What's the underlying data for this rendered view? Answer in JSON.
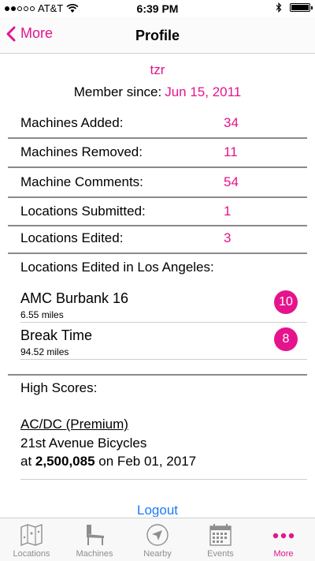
{
  "status_bar": {
    "carrier": "AT&T",
    "time": "6:39 PM"
  },
  "nav": {
    "back_label": "More",
    "title": "Profile"
  },
  "profile": {
    "username": "tzr",
    "member_since_label": "Member since:",
    "member_since_date": "Jun 15, 2011"
  },
  "stats": [
    {
      "label": "Machines Added:",
      "value": "34"
    },
    {
      "label": "Machines Removed:",
      "value": "11"
    },
    {
      "label": "Machine Comments:",
      "value": "54"
    },
    {
      "label": "Locations Submitted:",
      "value": "1"
    },
    {
      "label": "Locations Edited:",
      "value": "3"
    }
  ],
  "locations_section": {
    "title": "Locations Edited in Los Angeles:",
    "items": [
      {
        "name": "AMC Burbank 16",
        "distance": "6.55 miles",
        "count": "10"
      },
      {
        "name": "Break Time",
        "distance": "94.52 miles",
        "count": "8"
      }
    ]
  },
  "high_scores": {
    "title": "High Scores:",
    "entries": [
      {
        "machine": "AC/DC (Premium)",
        "location": "21st Avenue Bicycles",
        "at": "at",
        "score": "2,500,085",
        "on": "on Feb 01, 2017"
      }
    ]
  },
  "logout_label": "Logout",
  "tabs": [
    {
      "label": "Locations",
      "icon": "map-icon"
    },
    {
      "label": "Machines",
      "icon": "pinball-machine-icon"
    },
    {
      "label": "Nearby",
      "icon": "compass-icon"
    },
    {
      "label": "Events",
      "icon": "calendar-icon"
    },
    {
      "label": "More",
      "icon": "more-dots-icon",
      "active": true
    }
  ],
  "colors": {
    "accent": "#e5148c",
    "link": "#1a7cf5",
    "tab_inactive": "#8e8e8e"
  }
}
